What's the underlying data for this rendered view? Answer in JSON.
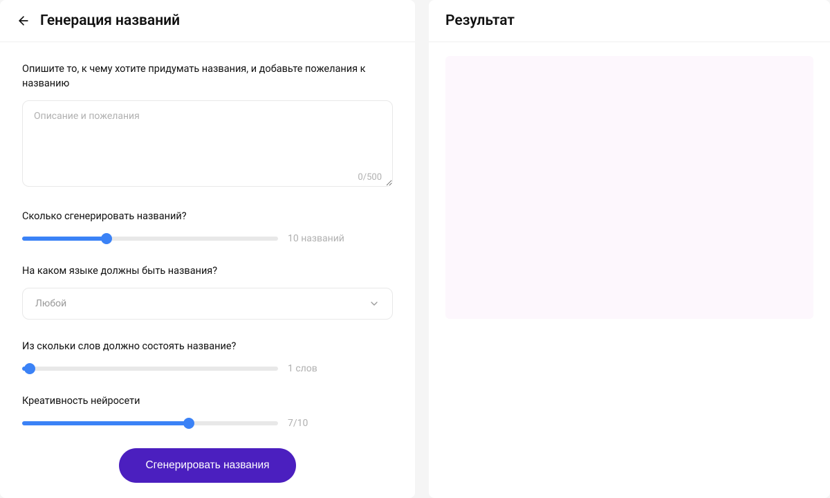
{
  "left": {
    "title": "Генерация названий",
    "description": {
      "label": "Опишите то, к чему хотите придумать названия, и добавьте пожелания к названию",
      "placeholder": "Описание и пожелания",
      "value": "",
      "counter": "0/500"
    },
    "count_slider": {
      "label": "Сколько сгенерировать названий?",
      "value": 10,
      "max": 30,
      "display": "10 названий",
      "fill_percent": 33
    },
    "language": {
      "label": "На каком языке должны быть названия?",
      "selected": "Любой"
    },
    "words_slider": {
      "label": "Из скольки слов должно состоять название?",
      "value": 1,
      "max": 10,
      "display": "1 слов",
      "fill_percent": 3
    },
    "creativity_slider": {
      "label": "Креативность нейросети",
      "value": 7,
      "max": 10,
      "display": "7/10",
      "fill_percent": 65
    },
    "generate_button": "Сгенерировать названия"
  },
  "right": {
    "title": "Результат"
  }
}
